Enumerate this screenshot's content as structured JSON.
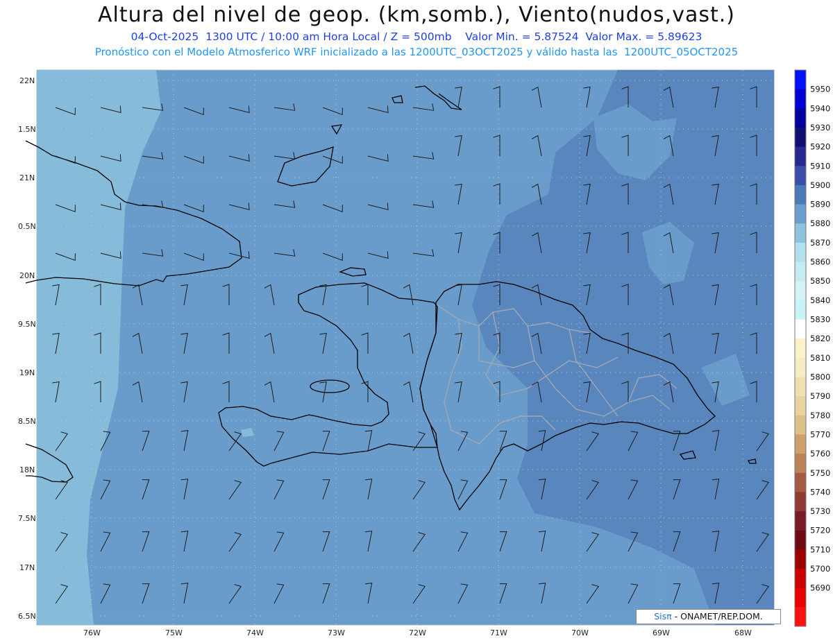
{
  "header": {
    "title": "Altura del nivel de geop. (km,somb.), Viento(nudos,vast.)",
    "line1": "04-Oct-2025  1300 UTC / 10:00 am Hora Local / Z = 500mb    Valor Min. = 5.87524  Valor Max. = 5.89623",
    "line2": "Pronóstico con el Modelo Atmosferico WRF inicializado a las 1200UTC_03OCT2025 y válido hasta las  1200UTC_05OCT2025"
  },
  "axes": {
    "lat_labels": [
      "22N",
      "1.5N",
      "21N",
      "0.5N",
      "20N",
      "9.5N",
      "19N",
      "8.5N",
      "18N",
      "7.5N",
      "17N",
      "6.5N"
    ],
    "lon_labels": [
      "76W",
      "75W",
      "74W",
      "73W",
      "72W",
      "71W",
      "70W",
      "69W",
      "68W"
    ]
  },
  "colorbar": {
    "labels": [
      "5950",
      "5940",
      "5930",
      "5920",
      "5910",
      "5900",
      "5890",
      "5880",
      "5870",
      "5860",
      "5850",
      "5840",
      "5830",
      "5820",
      "5810",
      "5800",
      "5790",
      "5780",
      "5770",
      "5760",
      "5750",
      "5740",
      "5730",
      "5720",
      "5710",
      "5700",
      "5690"
    ],
    "colors": [
      "#0010ff",
      "#0000d0",
      "#0000a0",
      "#10106e",
      "#28288f",
      "#3a4fa8",
      "#4a7ab8",
      "#6b9fcf",
      "#8ec3dd",
      "#b2e0ec",
      "#c6ebf2",
      "#d6f2f7",
      "#c9f4f7",
      "#ffffff",
      "#fbf2c8",
      "#f6ecc4",
      "#efe0b2",
      "#e9d4a0",
      "#dcc08a",
      "#cda06c",
      "#bb8358",
      "#a55a44",
      "#8e3c34",
      "#781c2a",
      "#6e0a12",
      "#9c0000",
      "#c80000",
      "#e80000",
      "#ff1010"
    ],
    "ocean_shade_level": "5880",
    "land_shade_level": "5890"
  },
  "credit": {
    "brand": "Sisπ",
    "rest": " - ONAMET/REP.DOM."
  }
}
